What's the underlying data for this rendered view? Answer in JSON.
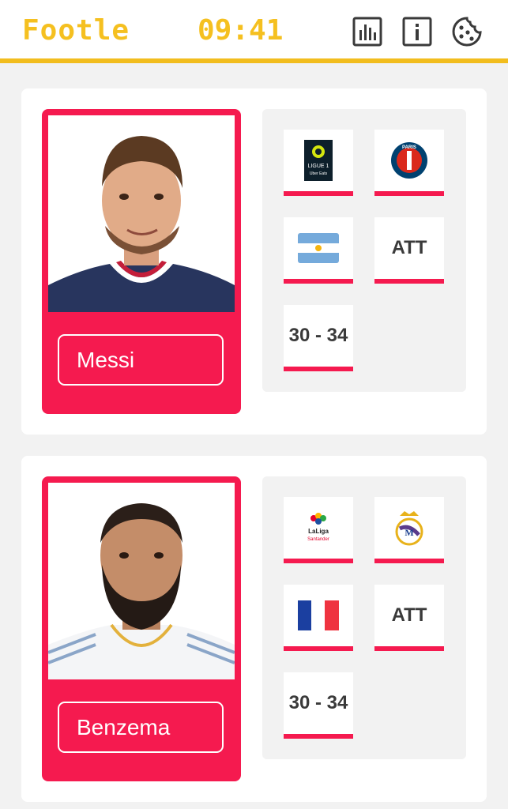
{
  "header": {
    "logo": "Footle",
    "timer": "09:41",
    "icons": [
      "stats-icon",
      "info-icon",
      "cookie-icon"
    ]
  },
  "colors": {
    "accent_yellow": "#f5c020",
    "card_red": "#f51a4f",
    "background": "#f2f2f2"
  },
  "players": [
    {
      "name": "Messi",
      "league_icon": "ligue1-logo",
      "league_logo_text": [
        "LIGUE 1",
        "Uber Eats"
      ],
      "club_icon": "psg-crest",
      "club_logo_text": "PARIS",
      "nation_icon": "argentina-flag",
      "position": "ATT",
      "age": "30 - 34"
    },
    {
      "name": "Benzema",
      "league_icon": "laliga-logo",
      "league_logo_text": [
        "LaLiga",
        "Santander"
      ],
      "club_icon": "real-madrid-crest",
      "nation_icon": "france-flag",
      "position": "ATT",
      "age": "30 - 34"
    }
  ]
}
